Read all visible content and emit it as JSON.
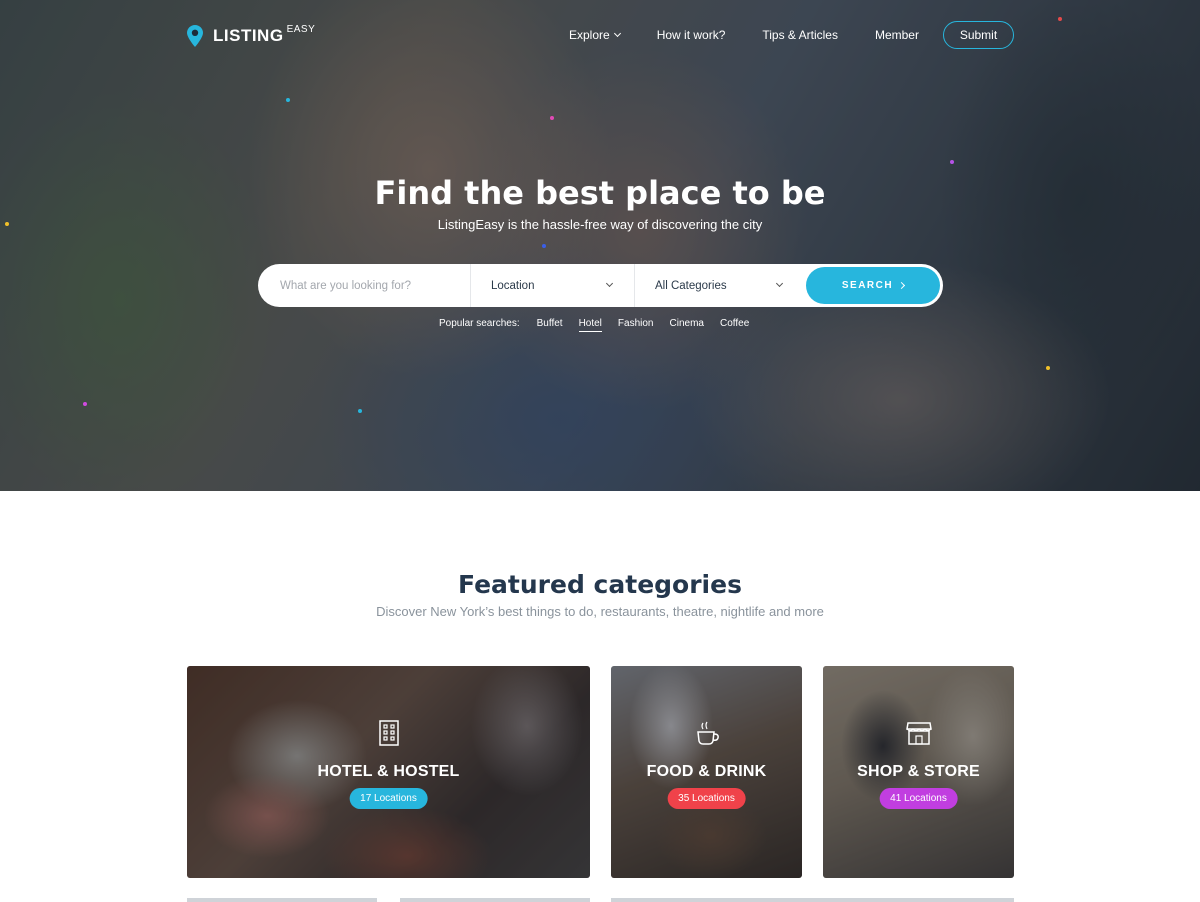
{
  "brand": {
    "name": "LISTING",
    "sup": "EASY",
    "accent": "#27b6dd"
  },
  "nav": {
    "items": [
      {
        "label": "Explore",
        "dropdown": true
      },
      {
        "label": "How it work?"
      },
      {
        "label": "Tips & Articles"
      },
      {
        "label": "Member"
      }
    ],
    "submit_label": "Submit"
  },
  "hero": {
    "title": "Find the best place to be",
    "subtitle": "ListingEasy is the hassle-free way of discovering the city"
  },
  "search": {
    "placeholder": "What are you looking for?",
    "location": "Location",
    "category": "All Categories",
    "button": "SEARCH"
  },
  "popular": {
    "label": "Popular searches:",
    "items": [
      "Buffet",
      "Hotel",
      "Fashion",
      "Cinema",
      "Coffee"
    ],
    "active": "Hotel"
  },
  "featured": {
    "title": "Featured categories",
    "subtitle": "Discover New York’s best things to do, restaurants, theatre, nightlife and more",
    "categories": [
      {
        "name": "HOTEL & HOSTEL",
        "count": "17 Locations",
        "badge_color": "#27b6dd",
        "icon": "building-icon"
      },
      {
        "name": "FOOD & DRINK",
        "count": "35 Locations",
        "badge_color": "#f0424a",
        "icon": "coffee-cup-icon"
      },
      {
        "name": "SHOP & STORE",
        "count": "41 Locations",
        "badge_color": "#c13ee0",
        "icon": "storefront-icon"
      }
    ]
  }
}
